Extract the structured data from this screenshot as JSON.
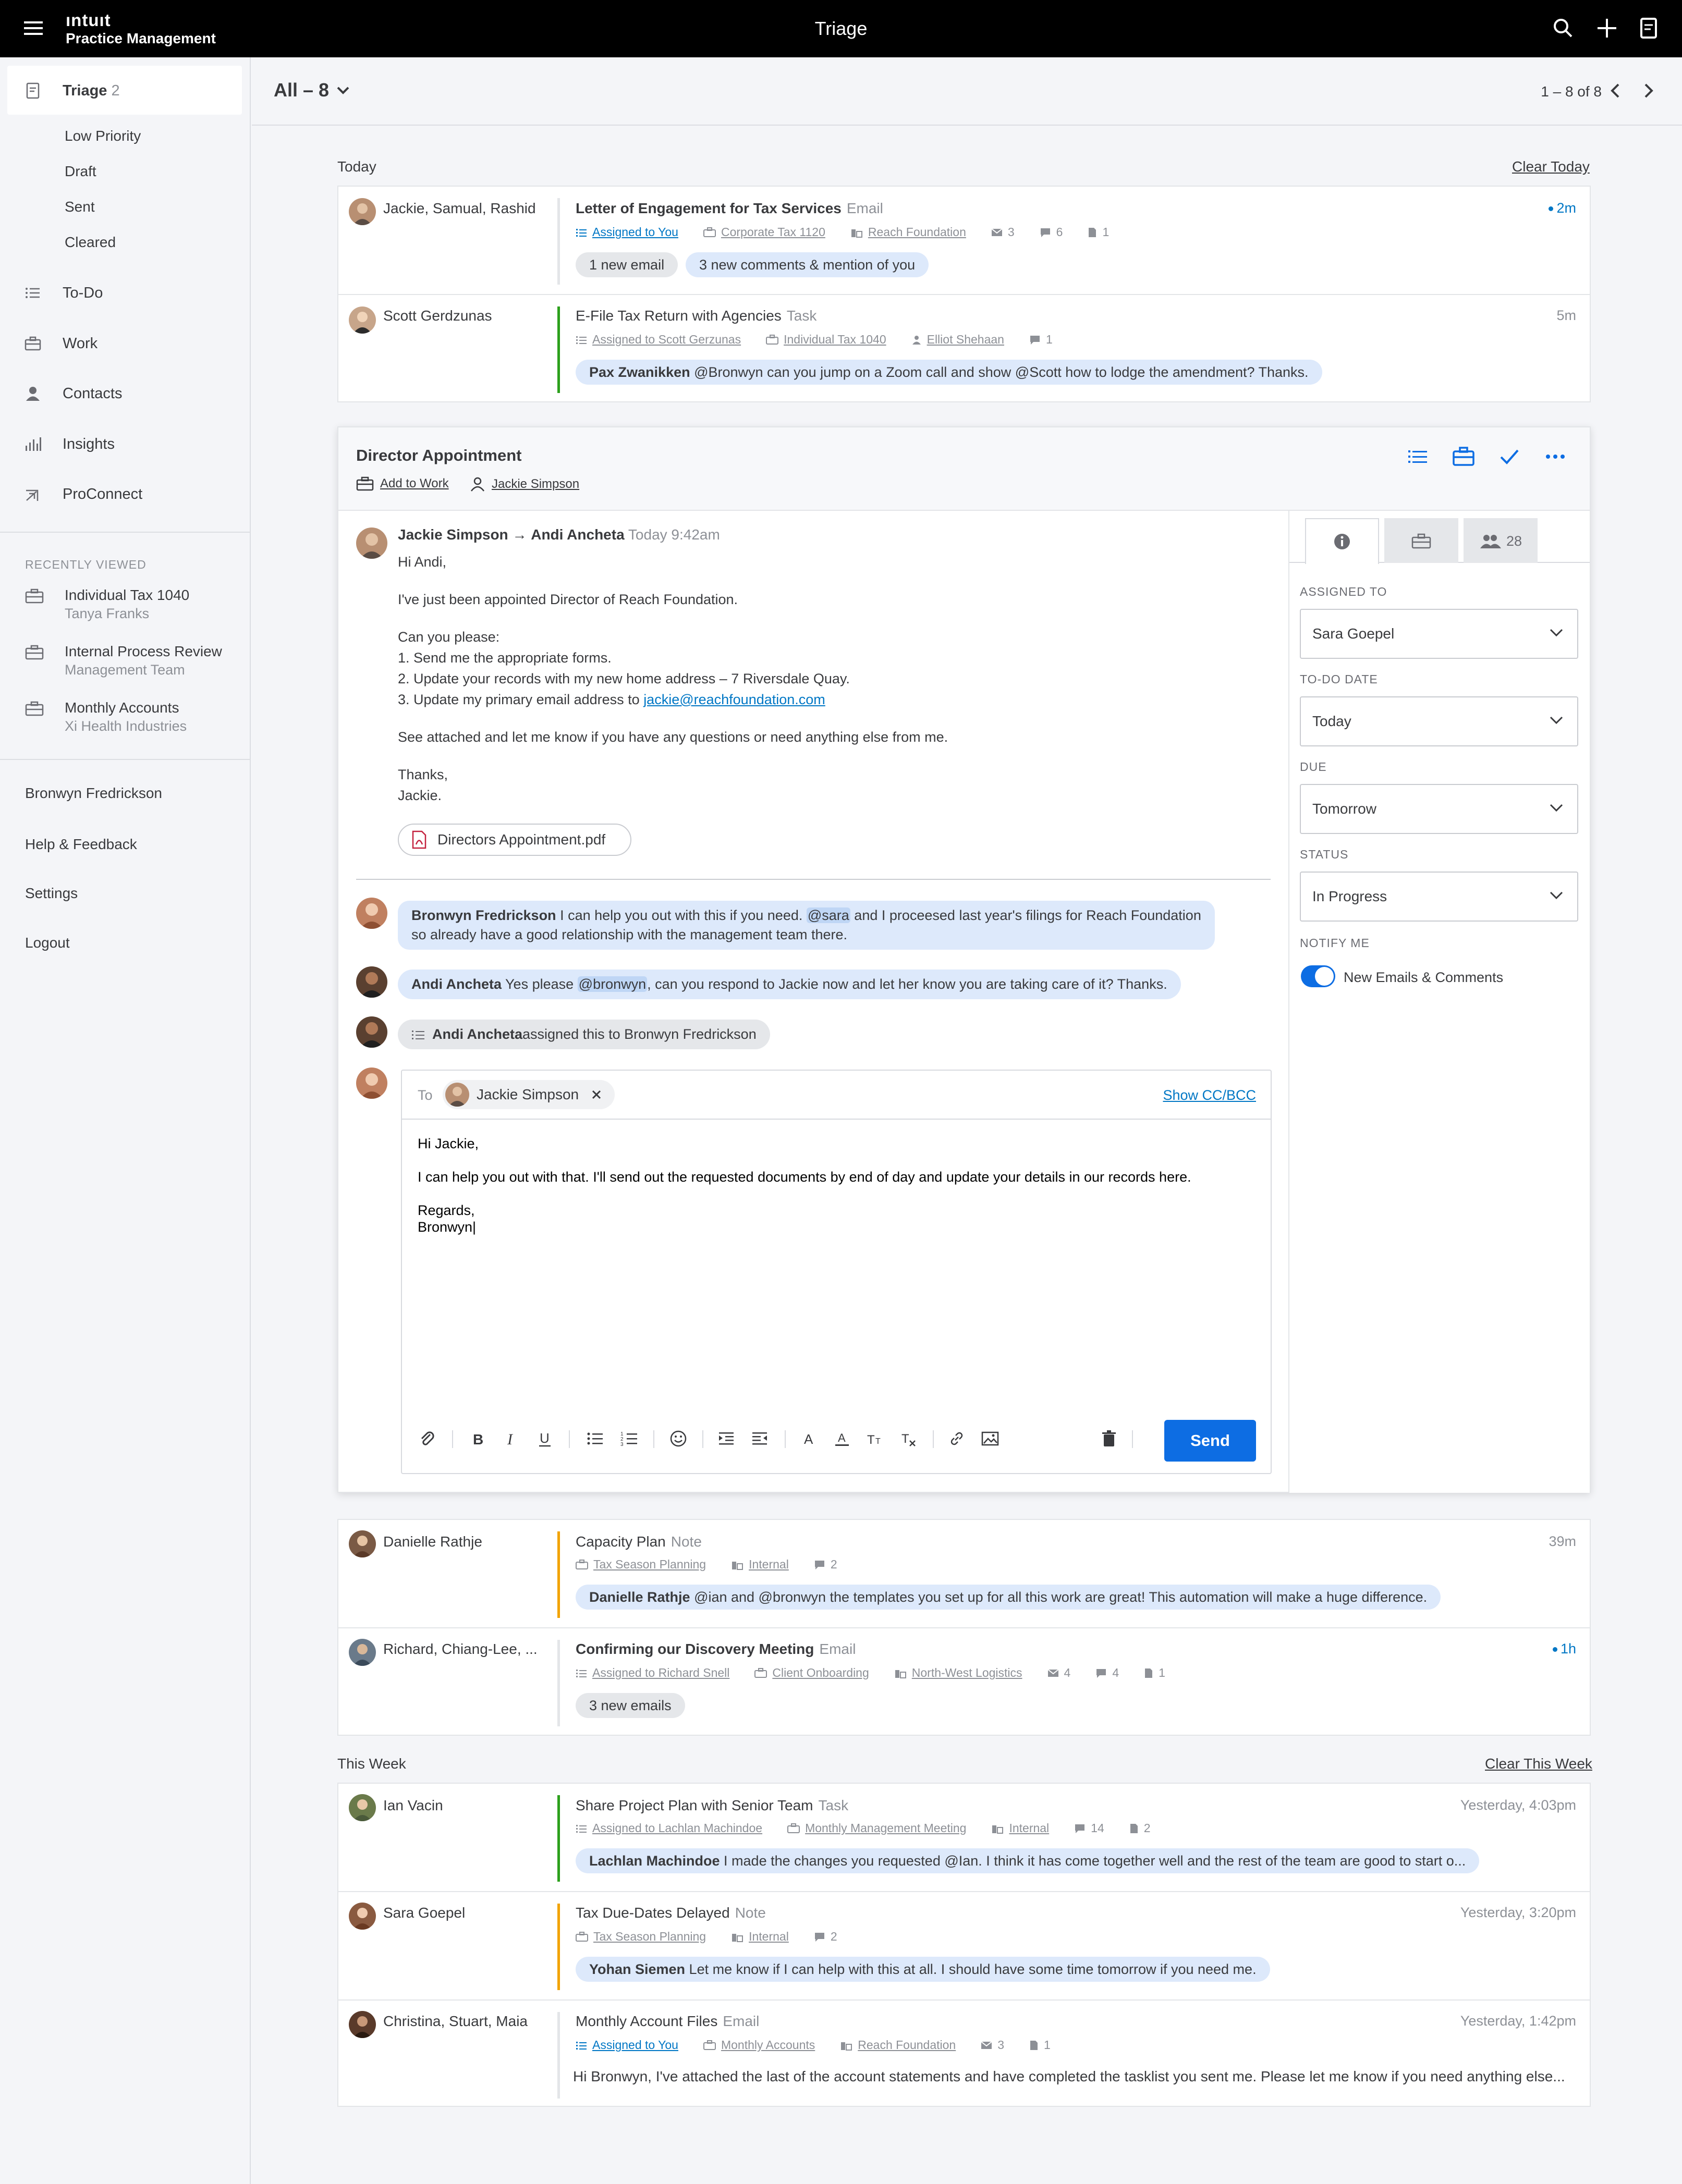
{
  "topbar": {
    "logo_top": "ıntuıt",
    "logo_bottom": "Practice Management",
    "title": "Triage"
  },
  "sidebar": {
    "triage_label": "Triage",
    "triage_count": "2",
    "triage_sub": [
      "Low Priority",
      "Draft",
      "Sent",
      "Cleared"
    ],
    "nav": [
      "To-Do",
      "Work",
      "Contacts",
      "Insights",
      "ProConnect"
    ],
    "recently_viewed_label": "RECENTLY VIEWED",
    "recent": [
      {
        "title": "Individual Tax 1040",
        "sub": "Tanya Franks"
      },
      {
        "title": "Internal Process Review",
        "sub": "Management Team"
      },
      {
        "title": "Monthly Accounts",
        "sub": "Xi Health Industries"
      }
    ],
    "links": [
      "Bronwyn Fredrickson",
      "Help & Feedback",
      "Settings",
      "Logout"
    ]
  },
  "header": {
    "filter": "All – 8",
    "pager": "1 – 8 of 8"
  },
  "sections": {
    "today": "Today",
    "clear_today": "Clear Today",
    "week": "This Week",
    "clear_week": "Clear This Week"
  },
  "items": [
    {
      "who": "Jackie, Samual, Rashid",
      "title": "Letter of Engagement for Tax Services",
      "type": "Email",
      "assigned": "Assigned to You",
      "work": "Corporate Tax 1120",
      "client": "Reach Foundation",
      "c1": "3",
      "c2": "6",
      "c3": "1",
      "chip1": "1 new email",
      "chip2": "3 new comments & mention of you",
      "time": "2m"
    },
    {
      "who": "Scott Gerdzunas",
      "title": "E-File Tax Return with Agencies",
      "type": "Task",
      "assigned": "Assigned to Scott Gerzunas",
      "work": "Individual Tax 1040",
      "client": "Elliot Shehaan",
      "c2": "1",
      "chip_name": "Pax Zwanikken",
      "chip_text": " @Bronwyn can you jump on a Zoom call and show @Scott how to lodge the amendment? Thanks.",
      "time": "5m"
    },
    {
      "who": "Danielle Rathje",
      "title": "Capacity Plan",
      "type": "Note",
      "work": "Tax Season Planning",
      "client": "Internal",
      "c2": "2",
      "chip_name": "Danielle Rathje",
      "chip_text": " @ian and @bronwyn the templates you set up for all this work are great! This automation will make a huge difference.",
      "time": "39m"
    },
    {
      "who": "Richard, Chiang-Lee, ...",
      "title": "Confirming our Discovery Meeting",
      "type": "Email",
      "assigned": "Assigned to Richard Snell",
      "work": "Client Onboarding",
      "client": "North-West Logistics",
      "c1": "4",
      "c2": "4",
      "c3": "1",
      "chip1": "3 new emails",
      "time": "1h"
    },
    {
      "who": "Ian Vacin",
      "title": "Share Project Plan with Senior Team",
      "type": "Task",
      "assigned": "Assigned to Lachlan Machindoe",
      "work": "Monthly Management Meeting",
      "client": "Internal",
      "c2": "14",
      "c3": "2",
      "chip_name": "Lachlan Machindoe",
      "chip_text": " I made the changes you requested @Ian. I think it has come together well and the rest of the team are good to start o...",
      "time": "Yesterday, 4:03pm"
    },
    {
      "who": "Sara Goepel",
      "title": "Tax Due-Dates Delayed",
      "type": "Note",
      "work": "Tax Season Planning",
      "client": "Internal",
      "c2": "2",
      "chip_name": "Yohan Siemen",
      "chip_text": " Let me know if I can help with this at all. I should have some time tomorrow if you need me.",
      "time": "Yesterday, 3:20pm"
    },
    {
      "who": "Christina, Stuart, Maia",
      "title": "Monthly Account Files",
      "type": "Email",
      "assigned": "Assigned to You",
      "work": "Monthly Accounts",
      "client": "Reach Foundation",
      "c1": "3",
      "c3": "1",
      "preview": "Hi Bronwyn, I've attached the last of the account statements and have completed the tasklist you sent me. Please let me know if you need anything else...",
      "time": "Yesterday, 1:42pm"
    }
  ],
  "open": {
    "title": "Director Appointment",
    "add_to_work": "Add to Work",
    "assignee": "Jackie Simpson",
    "from": "Jackie Simpson",
    "arrow": "→",
    "to": "Andi Ancheta",
    "date": "Today 9:42am",
    "body": [
      "Hi Andi,",
      "I've just been appointed Director of Reach Foundation.",
      "Can you please:",
      "1. Send me the appropriate forms.",
      "2. Update your records with my new home address – 7 Riversdale Quay.",
      "3. Update my primary email address to ",
      "See attached and let me know if you have any questions or need anything else from me.",
      "Thanks,",
      "Jackie."
    ],
    "email_link": "jackie@reachfoundation.com",
    "attachment": "Directors Appointment.pdf",
    "c1_name": "Bronwyn Fredrickson",
    "c1_a": " I can help you out with this if you need. ",
    "c1_m": "@sara",
    "c1_b": " and I proceesed last year's filings for Reach Foundation",
    "c1_line2": "so already have a good relationship with the management team there.",
    "c2_name": "Andi Ancheta",
    "c2_a": " Yes please ",
    "c2_m": "@bronwyn",
    "c2_b": ", can you respond to Jackie now and let her know you are taking care of it? Thanks.",
    "c3_name": "Andi Ancheta",
    "c3_text": " assigned this to Bronwyn Fredrickson",
    "compose": {
      "to_label": "To",
      "to_name": "Jackie Simpson",
      "cc": "Show CC/BCC",
      "lines": [
        "Hi Jackie,",
        "I can help you out with that. I'll send out the requested documents by end of day and update your details in our records here.",
        "Regards,",
        "Bronwyn|"
      ],
      "send": "Send"
    },
    "panel": {
      "people_count": "28",
      "assigned_label": "ASSIGNED TO",
      "assigned": "Sara Goepel",
      "todo_label": "TO-DO DATE",
      "todo": "Today",
      "due_label": "DUE",
      "due": "Tomorrow",
      "status_label": "STATUS",
      "status": "In Progress",
      "notify_label": "NOTIFY ME",
      "notify": "New Emails & Comments"
    }
  }
}
